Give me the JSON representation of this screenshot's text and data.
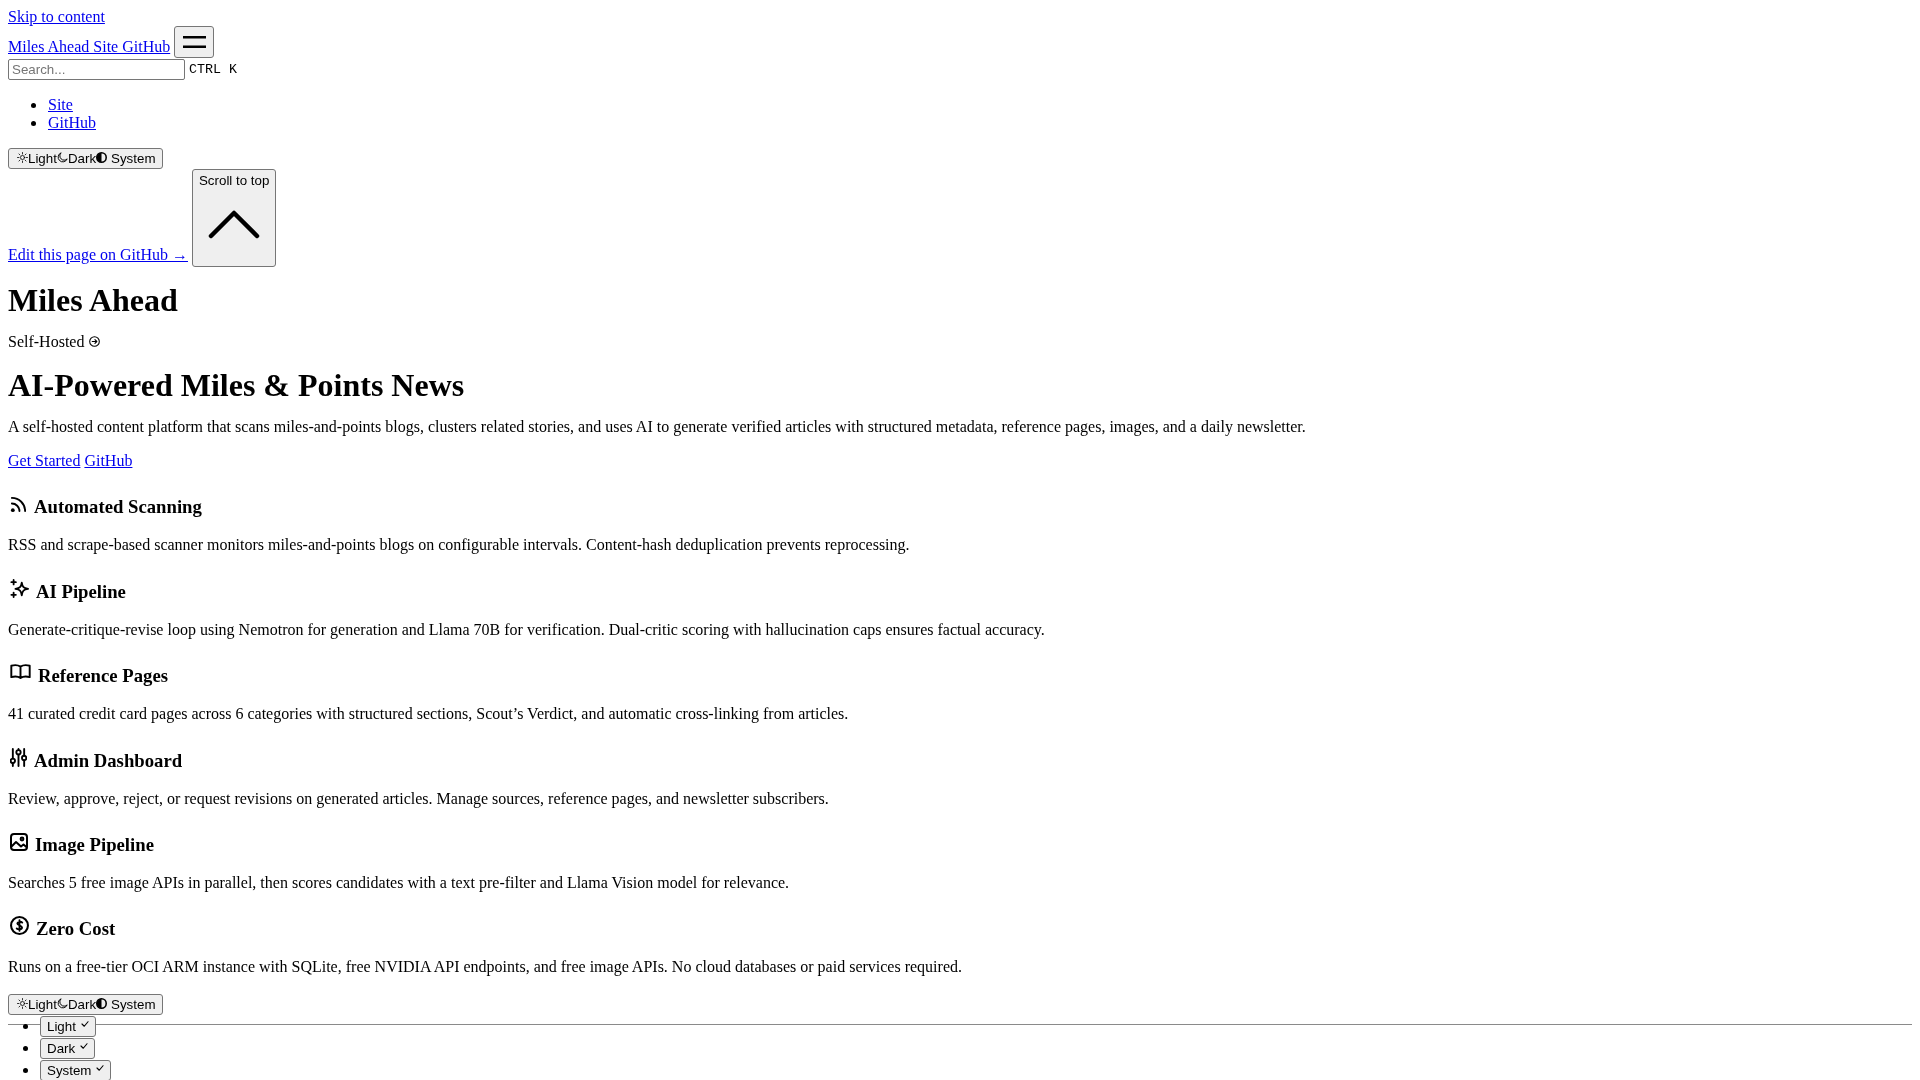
{
  "skip_link": "Skip to content",
  "header": {
    "site_title": "Miles Ahead Site GitHub"
  },
  "search": {
    "placeholder": "Search...",
    "shortcut": [
      "CTRL",
      "K"
    ]
  },
  "nav_links": [
    "Site",
    "GitHub"
  ],
  "theme_select": {
    "options": [
      {
        "kind": "light",
        "label": "Light"
      },
      {
        "kind": "dark",
        "label": "Dark"
      },
      {
        "kind": "system",
        "label": "System"
      }
    ]
  },
  "edit_link": "Edit this page on GitHub →",
  "scroll_to_top": "Scroll to top",
  "page_title": "Miles Ahead",
  "tagline": "Self-Hosted",
  "hero": {
    "title": "AI-Powered Miles & Points News",
    "description": "A self-hosted content platform that scans miles-and-points blogs, clusters related stories, and uses AI to generate verified articles with structured metadata, reference pages, images, and a daily newsletter.",
    "actions": [
      "Get Started",
      "GitHub"
    ]
  },
  "features": [
    {
      "kind": "rss",
      "title": "Automated Scanning",
      "description": "RSS and scrape-based scanner monitors miles-and-points blogs on configurable intervals. Content-hash deduplication prevents reprocessing."
    },
    {
      "kind": "sparkle",
      "title": "AI Pipeline",
      "description": "Generate-critique-revise loop using Nemotron for generation and Llama 70B for verification. Dual-critic scoring with hallucination caps ensures factual accuracy."
    },
    {
      "kind": "book",
      "title": "Reference Pages",
      "description": "41 curated credit card pages across 6 categories with structured sections, Scout’s Verdict, and automatic cross-linking from articles."
    },
    {
      "kind": "sliders",
      "title": "Admin Dashboard",
      "description": "Review, approve, reject, or request revisions on generated articles. Manage sources, reference pages, and newsletter subscribers."
    },
    {
      "kind": "image",
      "title": "Image Pipeline",
      "description": "Searches 5 free image APIs in parallel, then scores candidates with a text pre-filter and Llama Vision model for relevance."
    },
    {
      "kind": "dollar",
      "title": "Zero Cost",
      "description": "Runs on a free-tier OCI ARM instance with SQLite, free NVIDIA API endpoints, and free image APIs. No cloud databases or paid services required."
    }
  ],
  "footer_theme_select": {
    "options": [
      {
        "kind": "light",
        "label": "Light"
      },
      {
        "kind": "dark",
        "label": "Dark"
      },
      {
        "kind": "system",
        "label": "System"
      }
    ]
  },
  "theme_menu": [
    {
      "label": "Light",
      "checked": true
    },
    {
      "label": "Dark",
      "checked": true
    },
    {
      "label": "System",
      "checked": true
    }
  ]
}
